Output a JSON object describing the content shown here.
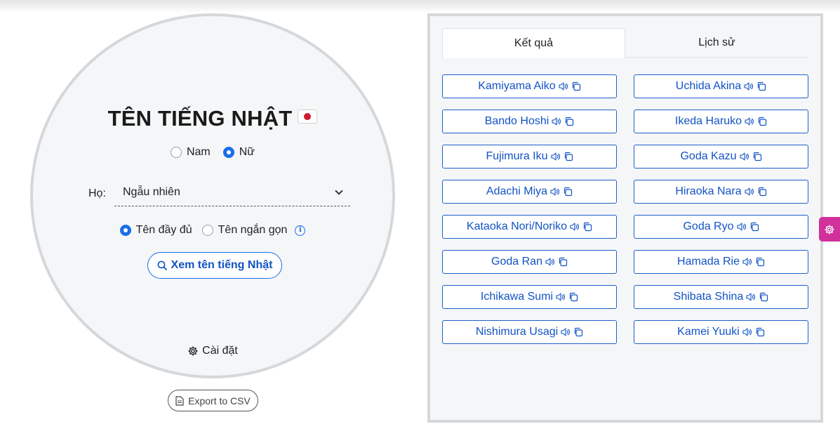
{
  "generator": {
    "title": "TÊN TIẾNG NHẬT",
    "gender_options": [
      {
        "label": "Nam",
        "selected": false
      },
      {
        "label": "Nữ",
        "selected": true
      }
    ],
    "surname_label": "Họ:",
    "surname_value": "Ngẫu nhiên",
    "name_type_options": [
      {
        "label": "Tên đầy đủ",
        "selected": true
      },
      {
        "label": "Tên ngắn gọn",
        "selected": false
      }
    ],
    "info_glyph": "i",
    "submit_label": "Xem tên tiếng Nhật",
    "settings_label": "Cài đặt",
    "export_label": "Export to CSV"
  },
  "results": {
    "tabs": [
      {
        "label": "Kết quả",
        "active": true
      },
      {
        "label": "Lịch sử",
        "active": false
      }
    ],
    "names": [
      "Kamiyama Aiko",
      "Uchida Akina",
      "Bando Hoshi",
      "Ikeda Haruko",
      "Fujimura Iku",
      "Goda Kazu",
      "Adachi Miya",
      "Hiraoka Nara",
      "Kataoka Nori/Noriko",
      "Goda Ryo",
      "Goda Ran",
      "Hamada Rie",
      "Ichikawa Sumi",
      "Shibata Shina",
      "Nishimura Usagi",
      "Kamei Yuuki"
    ]
  },
  "colors": {
    "accent": "#1a6fe8",
    "link": "#1253c4",
    "side_tab": "#d0319b",
    "panel_bg": "#f4f6f8"
  },
  "icons": [
    "japan-flag-icon",
    "chevron-down-icon",
    "info-icon",
    "search-icon",
    "gear-icon",
    "file-icon",
    "speaker-icon",
    "copy-icon"
  ]
}
